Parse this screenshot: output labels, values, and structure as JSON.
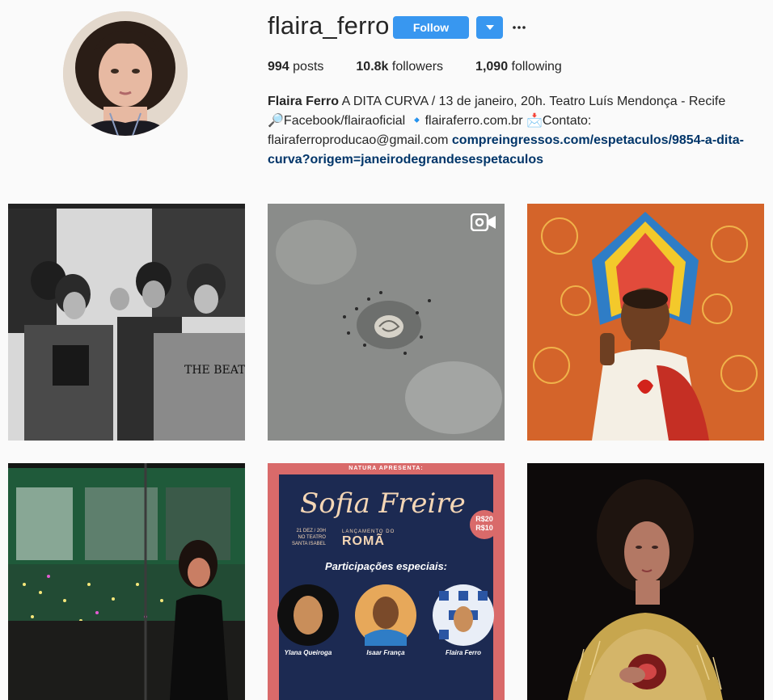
{
  "profile": {
    "username": "flaira_ferro",
    "follow_label": "Follow",
    "more_label": "···",
    "stats": {
      "posts_value": "994",
      "posts_label": "posts",
      "followers_value": "10.8k",
      "followers_label": "followers",
      "following_value": "1,090",
      "following_label": "following"
    },
    "bio": {
      "name": "Flaira Ferro",
      "line1": "A DITA CURVA / 13 de janeiro, 20h. Teatro Luís Mendonça - Recife",
      "facebook_emoji": "🔎",
      "facebook_text": "Facebook/flairaoficial",
      "site_emoji": "🔹",
      "site_text": "flairaferro.com.br",
      "contact_emoji": "📩",
      "contact_text": "Contato:",
      "email": "flairaferroproducao@gmail.com",
      "link": "compreingressos.com/espetaculos/9854-a-dita-curva?origem=janeirodegrandesespetaculos"
    }
  },
  "posts": [
    {
      "id": "group-photo",
      "overlay_text": "THE BEATLES"
    },
    {
      "id": "video-shell",
      "is_video": true
    },
    {
      "id": "jesus-art"
    },
    {
      "id": "bus-night"
    },
    {
      "id": "poster",
      "poster_header": "NATURA APRESENTA:",
      "poster_title": "Sofia Freire",
      "poster_subtitle": "LANÇAMENTO DO",
      "poster_album": "ROMÃ",
      "poster_date": "21 DEZ / 20H",
      "poster_venue1": "NO TEATRO",
      "poster_venue2": "SANTA ISABEL",
      "poster_price1": "R$20",
      "poster_price2": "R$10",
      "poster_guests_title": "Participações especiais:",
      "poster_guest1": "Ylana Queiroga",
      "poster_guest2": "Isaar França",
      "poster_guest3": "Flaira Ferro"
    },
    {
      "id": "pomegranate-portrait"
    }
  ],
  "colors": {
    "accent": "#3897f0",
    "link": "#003569",
    "poster_bg": "#1c2a52",
    "poster_border": "#d96a6a"
  }
}
